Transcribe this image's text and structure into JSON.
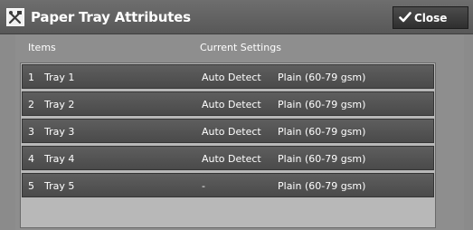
{
  "window": {
    "title": "Paper Tray Attributes",
    "icon": "paper-tray-tools-icon",
    "close_label": "Close"
  },
  "table": {
    "col_items": "Items",
    "col_settings": "Current Settings",
    "rows": [
      {
        "num": "1",
        "name": "Tray 1",
        "detect": "Auto Detect",
        "paper": "Plain (60-79 gsm)"
      },
      {
        "num": "2",
        "name": "Tray 2",
        "detect": "Auto Detect",
        "paper": "Plain (60-79 gsm)"
      },
      {
        "num": "3",
        "name": "Tray 3",
        "detect": "Auto Detect",
        "paper": "Plain (60-79 gsm)"
      },
      {
        "num": "4",
        "name": "Tray 4",
        "detect": "Auto Detect",
        "paper": "Plain (60-79 gsm)"
      },
      {
        "num": "5",
        "name": "Tray 5",
        "detect": "-",
        "paper": "Plain (60-79 gsm)"
      }
    ]
  },
  "colors": {
    "titlebar": "#585858",
    "row": "#4f4f4f",
    "panel": "#b8b8b8",
    "background": "#8b8b8b"
  }
}
